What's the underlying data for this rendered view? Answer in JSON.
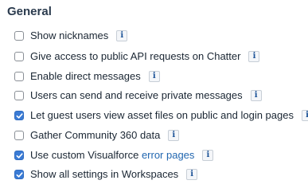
{
  "section": {
    "title": "General"
  },
  "settings": [
    {
      "label": "Show nicknames",
      "checked": false,
      "info": "i"
    },
    {
      "label": "Give access to public API requests on Chatter",
      "checked": false,
      "info": "i"
    },
    {
      "label": "Enable direct messages",
      "checked": false,
      "info": "i"
    },
    {
      "label": "Users can send and receive private messages",
      "checked": false,
      "info": "i"
    },
    {
      "label": "Let guest users view asset files on public and login pages",
      "checked": true,
      "info": "i"
    },
    {
      "label": "Gather Community 360 data",
      "checked": false,
      "info": "i"
    },
    {
      "label_prefix": "Use custom Visualforce ",
      "label_link": "error pages",
      "checked": true,
      "info": "i"
    },
    {
      "label": "Show all settings in Workspaces",
      "checked": true,
      "info": "i"
    }
  ],
  "icons": {
    "info": "info-icon",
    "checkmark": "checkmark-icon"
  },
  "colors": {
    "checkbox_checked": "#3a7bd5",
    "link": "#2267b0",
    "info_text": "#1b5297"
  }
}
